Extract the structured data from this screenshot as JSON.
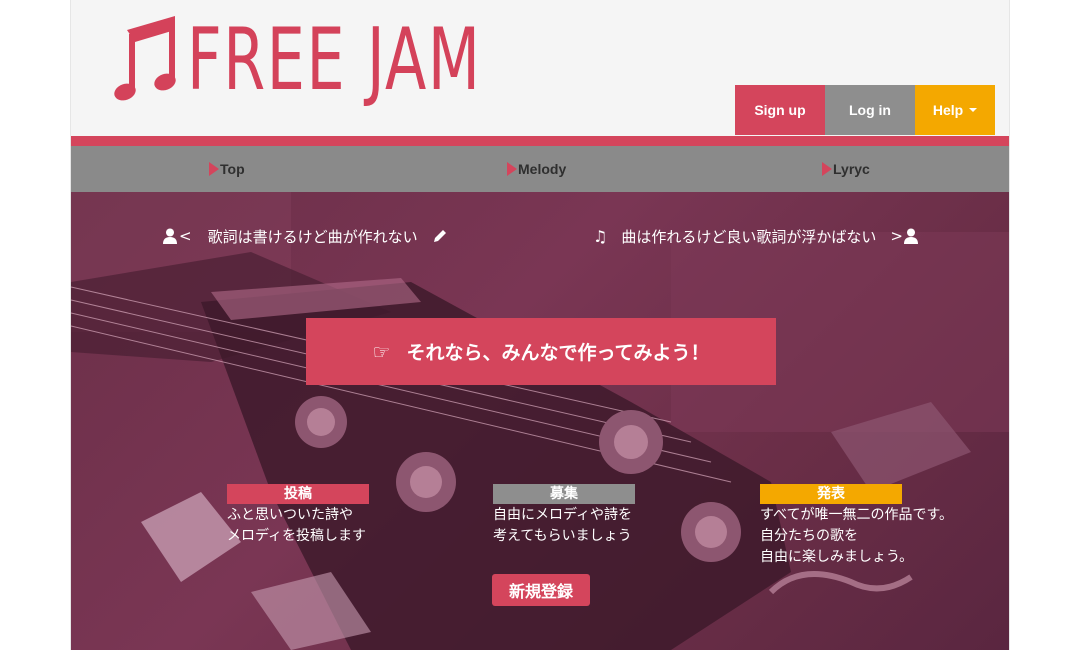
{
  "brand": {
    "name": "FREE JAM",
    "color": "#d4425a"
  },
  "header": {
    "signup_label": "Sign up",
    "login_label": "Log in",
    "help_label": "Help"
  },
  "nav": {
    "items": [
      {
        "label": "Top"
      },
      {
        "label": "Melody"
      },
      {
        "label": "Lyryc"
      }
    ]
  },
  "hero": {
    "left_prefix": "<",
    "left_text": "歌詞は書けるけど曲が作れない",
    "right_text": "曲は作れるけど良い歌詞が浮かばない",
    "right_suffix": ">",
    "cta_label": "それなら、みんなで作ってみよう！",
    "features": [
      {
        "label": "投稿",
        "color": "#d4455c",
        "line1": "ふと思いついた詩や",
        "line2": "メロディを投稿します"
      },
      {
        "label": "募集",
        "color": "#8e8e8e",
        "line1": "自由にメロディや詩を",
        "line2": "考えてもらいましょう"
      },
      {
        "label": "発表",
        "color": "#f4a800",
        "line1": "すべてが唯一無二の作品です。",
        "line2": "自分たちの歌を",
        "line3": "自由に楽しみましょう。"
      }
    ],
    "register_label": "新規登録"
  },
  "colors": {
    "accent": "#d4455c",
    "gray": "#8e8e8e",
    "yellow": "#f4a800",
    "hero_tint": "#6b2f48"
  },
  "icons": [
    "music-note-icon",
    "user-icon",
    "pencil-icon",
    "pointing-hand-icon"
  ]
}
